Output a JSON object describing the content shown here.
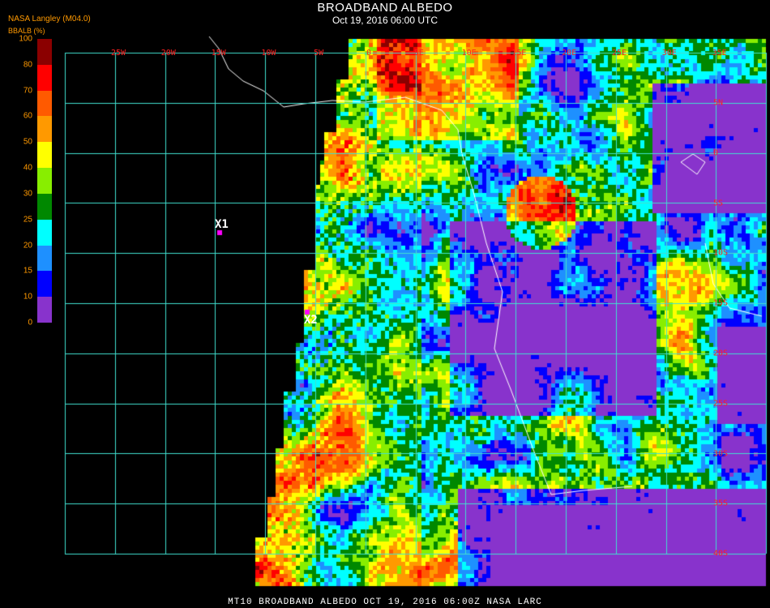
{
  "header": {
    "title": "BROADBAND ALBEDO",
    "subtitle": "Oct 19, 2016 06:00 UTC",
    "agency": "NASA Langley (M04.0)",
    "colorbar_title": "BBALB (%)"
  },
  "legend": {
    "ticks": [
      "100",
      "80",
      "70",
      "60",
      "50",
      "40",
      "30",
      "25",
      "20",
      "15",
      "10",
      "0"
    ],
    "colors": [
      "#8b0000",
      "#ff0000",
      "#ff5a00",
      "#ff9900",
      "#ffff00",
      "#88ee00",
      "#008800",
      "#00ffff",
      "#1e90ff",
      "#0000ff",
      "#8833cc"
    ]
  },
  "grid": {
    "lon_labels": [
      "25W",
      "20W",
      "15W",
      "10W",
      "5W",
      "0",
      "5E",
      "10E",
      "15E",
      "20E",
      "25E",
      "30E",
      "35E"
    ],
    "lat_labels": [
      "5N",
      "0",
      "5S",
      "10S",
      "15S",
      "20S",
      "25S",
      "30S",
      "35S",
      "40S"
    ],
    "line_color": "#40e0d0"
  },
  "markers": [
    {
      "label": "X1"
    },
    {
      "label": "X2"
    }
  ],
  "footer": "MT10  BROADBAND ALBEDO   OCT 19, 2016 06:00Z   NASA LARC"
}
